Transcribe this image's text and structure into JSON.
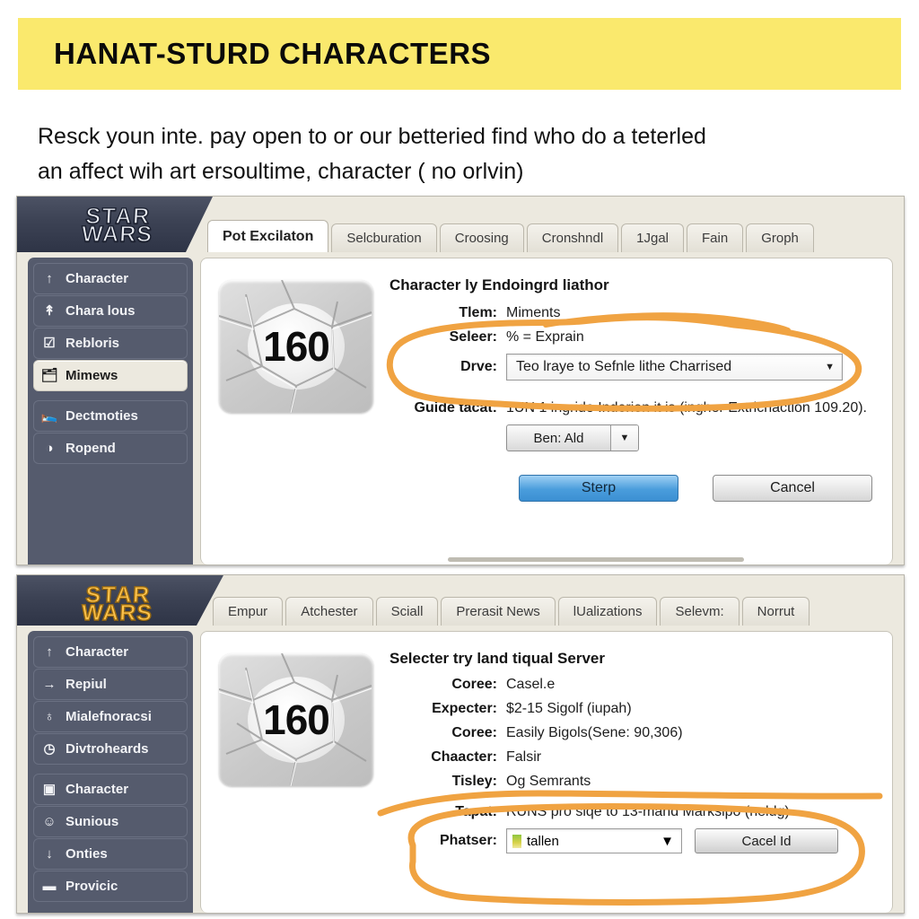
{
  "banner": {
    "title": "HANAT-STURD CHARACTERS",
    "bg": "#fae96d"
  },
  "intro": {
    "line1": "Resck youn inte. pay open to or our betteried find who do a teterled",
    "line2": "an affect wih art ersoultime, character ( no orlvin)"
  },
  "annotation": {
    "color": "#f0a342"
  },
  "panel1": {
    "logo": {
      "line1": "STAR",
      "line2": "WARS",
      "style": "silver"
    },
    "tabs": [
      {
        "label": "Pot Excilaton",
        "active": true
      },
      {
        "label": "Selcburation",
        "active": false
      },
      {
        "label": "Croosing",
        "active": false
      },
      {
        "label": "Cronshndl",
        "active": false
      },
      {
        "label": "1Jgal",
        "active": false
      },
      {
        "label": "Fain",
        "active": false
      },
      {
        "label": "Groph",
        "active": false
      }
    ],
    "sidebar": {
      "group1": [
        {
          "icon": "arrow-up-icon",
          "glyph": "↑",
          "label": "Character",
          "selected": false
        },
        {
          "icon": "arrow-up-thin-icon",
          "glyph": "↑",
          "label": "Chara lous",
          "selected": false
        },
        {
          "icon": "check-circle-icon",
          "glyph": "✔",
          "label": "Rebloris",
          "selected": false
        },
        {
          "icon": "folder-icon",
          "glyph": "▭",
          "label": "Mimews",
          "selected": true
        }
      ],
      "group2": [
        {
          "icon": "bed-icon",
          "glyph": "▤",
          "label": "Dectmoties",
          "selected": false
        },
        {
          "icon": "globe-icon",
          "glyph": "◑",
          "label": "Ropend",
          "selected": false
        }
      ]
    },
    "badge": {
      "value": "160"
    },
    "form": {
      "title": "Character ly Endoingrd liathor",
      "rows": [
        {
          "label": "Tlem:",
          "value": "Miments"
        },
        {
          "label": "Seleer:",
          "value": "% = Exprain"
        }
      ],
      "drive_label": "Drve:",
      "drive_value": "Teo lraye to Sefnle lithe Charrised",
      "guide_label": "Guide tacat:",
      "guide_value": "1UN 1 ingride Inderien it is (ingher Extrichaction 109.20).",
      "small_select_value": "Ben: Ald",
      "primary_button": "Sterp",
      "secondary_button": "Cancel"
    }
  },
  "panel2": {
    "logo": {
      "line1": "STAR",
      "line2": "WARS",
      "style": "gold"
    },
    "tabs": [
      {
        "label": "Empur",
        "active": false
      },
      {
        "label": "Atchester",
        "active": false
      },
      {
        "label": "Sciall",
        "active": false
      },
      {
        "label": "Prerasit News",
        "active": false
      },
      {
        "label": "lUalizations",
        "active": false
      },
      {
        "label": "Selevm:",
        "active": false
      },
      {
        "label": "Norrut",
        "active": false
      }
    ],
    "sidebar": {
      "group1": [
        {
          "icon": "arrow-up-icon",
          "glyph": "↑",
          "label": "Character",
          "selected": false
        },
        {
          "icon": "arrow-right-icon",
          "glyph": "→",
          "label": "Repiul",
          "selected": false
        },
        {
          "icon": "anchor-icon",
          "glyph": "♁",
          "label": "Mialefnoracsi",
          "selected": false
        },
        {
          "icon": "power-circle-icon",
          "glyph": "⏻",
          "label": "Divtroheards",
          "selected": false
        }
      ],
      "group2": [
        {
          "icon": "book-icon",
          "glyph": "▥",
          "label": "Character",
          "selected": false
        },
        {
          "icon": "person-icon",
          "glyph": "☺",
          "label": "Sunious",
          "selected": false
        },
        {
          "icon": "arrow-down-icon",
          "glyph": "↓",
          "label": "Onties",
          "selected": false
        },
        {
          "icon": "card-icon",
          "glyph": "▭",
          "label": "Provicic",
          "selected": false
        }
      ]
    },
    "badge": {
      "value": "160"
    },
    "form": {
      "title": "Selecter try land tiqual Server",
      "rows": [
        {
          "label": "Coree:",
          "value": "Casel.e"
        },
        {
          "label": "Expecter:",
          "value": "$2-15 Sigolf (iupah)"
        },
        {
          "label": "Coree:",
          "value": "Easily Bigols(Sene: 90,306)"
        },
        {
          "label": "Chaacter:",
          "value": "Falsir"
        },
        {
          "label": "Tisley:",
          "value": "Og Semrants"
        }
      ],
      "tapat_label": "Tapat:",
      "tapat_value": "RUNS pro siqe to 13-mand Marksipo (neldg)",
      "phatser_label": "Phatser:",
      "phatser_value": "tallen",
      "cancel_button": "Cacel Id"
    }
  }
}
